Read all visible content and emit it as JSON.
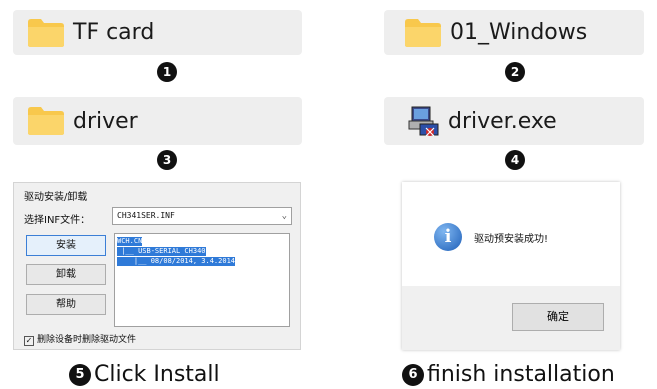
{
  "steps": [
    {
      "number": "1",
      "label": "TF card",
      "icon": "folder-icon"
    },
    {
      "number": "2",
      "label": "01_Windows",
      "icon": "folder-icon"
    },
    {
      "number": "3",
      "label": "driver",
      "icon": "folder-icon"
    },
    {
      "number": "4",
      "label": "driver.exe",
      "icon": "installer-exe-icon"
    }
  ],
  "install_dialog": {
    "title": "驱动安装/卸载",
    "select_label": "选择INF文件：",
    "select_value": "CH341SER.INF",
    "buttons": {
      "install": "安装",
      "uninstall": "卸载",
      "help": "帮助"
    },
    "log_lines": [
      "WCH.CN",
      " |__ USB-SERIAL CH340",
      "    |__ 08/08/2014, 3.4.2014"
    ],
    "checkbox_label": "删除设备时删除驱动文件"
  },
  "success_dialog": {
    "message": "驱动预安装成功!",
    "ok_label": "确定"
  },
  "captions": {
    "step5_number": "5",
    "step5_text": "Click Install",
    "step6_number": "6",
    "step6_text": "finish installation"
  },
  "colors": {
    "folder": "#f8c84c",
    "tile_bg": "#eeeeee",
    "highlight": "#2f7ad8"
  }
}
